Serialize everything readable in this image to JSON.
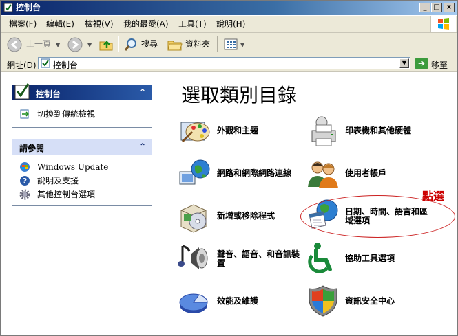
{
  "window": {
    "title": "控制台"
  },
  "menu": {
    "items": [
      "檔案(F)",
      "編輯(E)",
      "檢視(V)",
      "我的最愛(A)",
      "工具(T)",
      "說明(H)"
    ]
  },
  "toolbar": {
    "back": "上一頁",
    "search": "搜尋",
    "folders": "資料夾"
  },
  "address": {
    "label": "網址(D)",
    "value": "控制台",
    "go": "移至"
  },
  "left_panel": {
    "control_panel": {
      "title": "控制台",
      "link": "切換到傳統檢視"
    },
    "see_also": {
      "title": "請參閱",
      "links": [
        "Windows Update",
        "說明及支援",
        "其他控制台選項"
      ]
    }
  },
  "main": {
    "title": "選取類別目錄",
    "categories": [
      "外觀和主題",
      "印表機和其他硬體",
      "網路和網際網路連線",
      "使用者帳戶",
      "新增或移除程式",
      "日期、時間、語言和區域選項",
      "聲音、語音、和音訊裝置",
      "協助工具選項",
      "效能及維護",
      "資訊安全中心"
    ],
    "annotation": "點選"
  },
  "colors": {
    "titlebar": "#0a246a",
    "panel_header": "#0a246a",
    "panel_header_2": "#d6dff7",
    "annotation": "#cc0000"
  }
}
